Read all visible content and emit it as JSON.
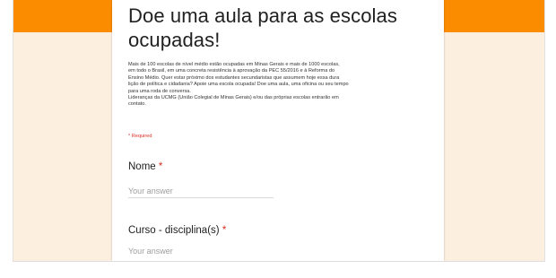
{
  "form": {
    "title_line1": "Doe uma aula para as escolas",
    "title_line2": "ocupadas!",
    "description": [
      "Mais de 100 escolas de nível médio estão ocupadas em Minas Gerais e mais de 1000 escolas,",
      "em todo o Brasil, em uma concreta resistência à aprovação da PEC 55/2016 e à Reforma do",
      "Ensino Médio. Quer estar próximo dos estudantes secundaristas que assumem hoje essa dura",
      "lição de política e cidadania? Apoie uma escola ocupada! Doe uma aula, uma oficina ou seu tempo",
      "para uma roda de conversa.",
      "Lideranças da UCMG (União Colegial de Minas Gerais) e/ou das próprias escolas entrarão em",
      "contato."
    ],
    "required_note": "* Required",
    "questions": [
      {
        "label": "Nome",
        "star": "*",
        "placeholder": "Your answer"
      },
      {
        "label": "Curso - disciplina(s)",
        "star": "*",
        "placeholder": "Your answer"
      }
    ]
  },
  "colors": {
    "header_band": "#fb8c00",
    "background": "#fdefe0",
    "required": "#d93025"
  }
}
